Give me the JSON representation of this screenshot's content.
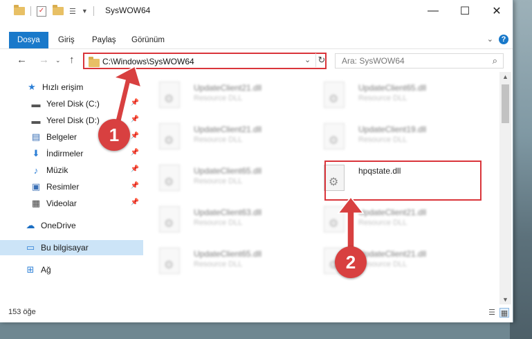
{
  "window": {
    "title": "SysWOW64",
    "controls": {
      "minimize": "—",
      "maximize": "☐",
      "close": "✕"
    }
  },
  "ribbon": {
    "tabs": [
      "Dosya",
      "Giriş",
      "Paylaş",
      "Görünüm"
    ],
    "help": "?"
  },
  "address": {
    "path": "C:\\Windows\\SysWOW64",
    "search_placeholder": "Ara: SysWOW64"
  },
  "sidebar": {
    "quick_access": "Hızlı erişim",
    "items": [
      "Yerel Disk (C:)",
      "Yerel Disk (D:)",
      "Belgeler",
      "İndirmeler",
      "Müzik",
      "Resimler",
      "Videolar"
    ],
    "onedrive": "OneDrive",
    "this_pc": "Bu bilgisayar",
    "network": "Ağ"
  },
  "files": {
    "left": [
      {
        "name": "UpdateClient21.dll",
        "desc": "Resource DLL"
      },
      {
        "name": "UpdateClient21.dll",
        "desc": "Resource DLL"
      },
      {
        "name": "UpdateClient65.dll",
        "desc": "Resource DLL"
      },
      {
        "name": "UpdateClient63.dll",
        "desc": "Resource DLL"
      },
      {
        "name": "UpdateClient65.dll",
        "desc": "Resource DLL"
      }
    ],
    "right": [
      {
        "name": "UpdateClient65.dll",
        "desc": "Resource DLL"
      },
      {
        "name": "UpdateClient19.dll",
        "desc": "Resource DLL"
      },
      {
        "name": "hpqstate.dll",
        "desc": ""
      },
      {
        "name": "UpdateClient21.dll",
        "desc": "Resource DLL"
      },
      {
        "name": "UpdateClient21.dll",
        "desc": "Resource DLL"
      }
    ]
  },
  "status": {
    "item_count": "153 öğe"
  },
  "annotations": {
    "step1": "1",
    "step2": "2",
    "color": "#d84040"
  }
}
